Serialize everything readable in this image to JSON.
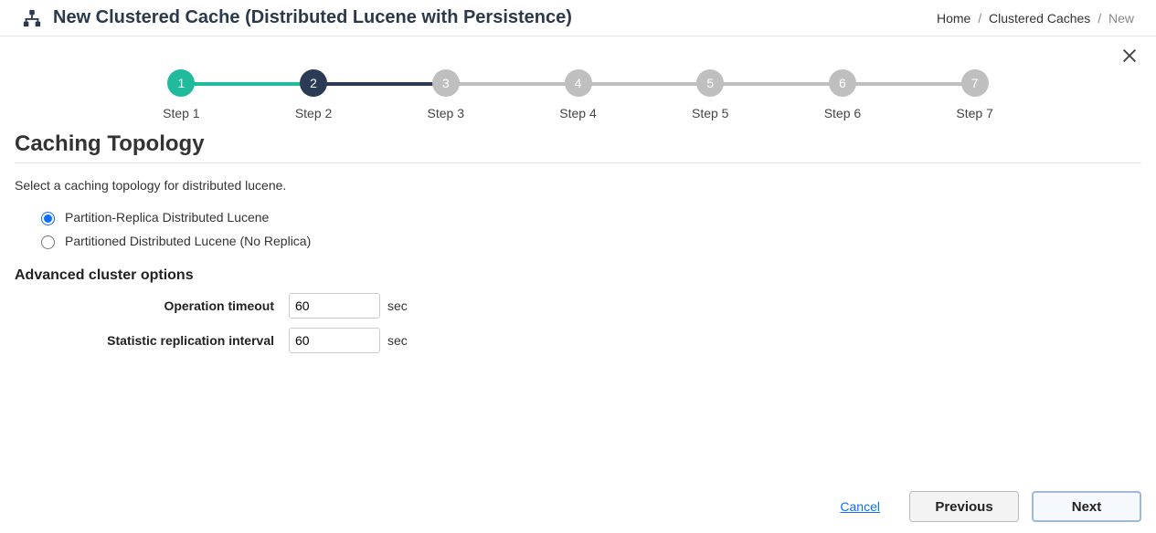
{
  "header": {
    "title": "New Clustered Cache (Distributed Lucene with Persistence)",
    "breadcrumb": {
      "home": "Home",
      "caches": "Clustered Caches",
      "current": "New"
    }
  },
  "stepper": {
    "steps": [
      {
        "num": "1",
        "label": "Step 1",
        "state": "done",
        "bar": "done"
      },
      {
        "num": "2",
        "label": "Step 2",
        "state": "active",
        "bar": "active"
      },
      {
        "num": "3",
        "label": "Step 3",
        "state": "pending",
        "bar": "pending"
      },
      {
        "num": "4",
        "label": "Step 4",
        "state": "pending",
        "bar": "pending"
      },
      {
        "num": "5",
        "label": "Step 5",
        "state": "pending",
        "bar": "pending"
      },
      {
        "num": "6",
        "label": "Step 6",
        "state": "pending",
        "bar": "pending"
      },
      {
        "num": "7",
        "label": "Step 7",
        "state": "pending",
        "bar": ""
      }
    ]
  },
  "section": {
    "title": "Caching Topology",
    "instruction": "Select a caching topology for distributed lucene."
  },
  "topology": {
    "options": [
      {
        "label": "Partition-Replica Distributed Lucene",
        "selected": true
      },
      {
        "label": "Partitioned Distributed Lucene (No Replica)",
        "selected": false
      }
    ]
  },
  "advanced": {
    "heading": "Advanced cluster options",
    "operation_timeout_label": "Operation timeout",
    "operation_timeout_value": "60",
    "operation_timeout_unit": "sec",
    "stat_interval_label": "Statistic replication interval",
    "stat_interval_value": "60",
    "stat_interval_unit": "sec"
  },
  "footer": {
    "cancel": "Cancel",
    "previous": "Previous",
    "next": "Next"
  }
}
